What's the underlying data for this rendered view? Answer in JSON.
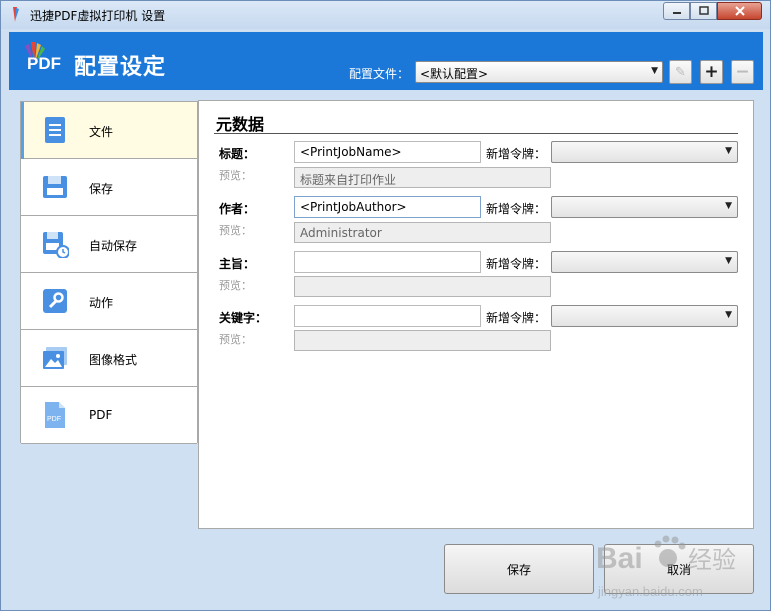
{
  "window": {
    "title": "迅捷PDF虚拟打印机 设置",
    "controls": {
      "minimize_icon": "minimize-icon",
      "maximize_icon": "maximize-icon",
      "close_icon": "close-icon"
    }
  },
  "header": {
    "logo_text": "PDF",
    "title": "配置设定",
    "profile_label": "配置文件：",
    "profile_value": "<默认配置>",
    "accent": "#1b78d8"
  },
  "sidebar": {
    "items": [
      {
        "label": "文件",
        "icon": "document-icon",
        "active": true
      },
      {
        "label": "保存",
        "icon": "save-disk-icon"
      },
      {
        "label": "自动保存",
        "icon": "autosave-clock-icon"
      },
      {
        "label": "动作",
        "icon": "wrench-icon"
      },
      {
        "label": "图像格式",
        "icon": "image-icon"
      },
      {
        "label": "PDF",
        "icon": "pdf-file-icon"
      }
    ]
  },
  "metadata": {
    "section_title": "元数据",
    "token_label": "新增令牌：",
    "preview_label": "预览：",
    "fields": [
      {
        "label": "标题：",
        "value": "<PrintJobName>",
        "preview": "标题来自打印作业"
      },
      {
        "label": "作者：",
        "value": "<PrintJobAuthor>",
        "preview": "Administrator"
      },
      {
        "label": "主旨：",
        "value": "",
        "preview": ""
      },
      {
        "label": "关键字：",
        "value": "",
        "preview": ""
      }
    ]
  },
  "footer": {
    "save_label": "保存",
    "cancel_label": "取消"
  },
  "watermark": {
    "brand": "Bai",
    "brand_suffix": "经验",
    "url": "jingyan.baidu.com"
  }
}
